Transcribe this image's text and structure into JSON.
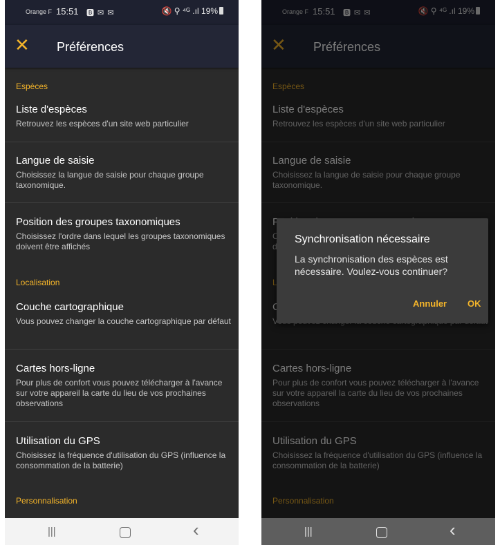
{
  "status_bar": {
    "carrier": "Orange F",
    "time": "15:51",
    "notifications": "🅱 ✉ ✉",
    "system_icons": "🔇 ⚲ ⁴ᴳ .ıl",
    "battery": "19%"
  },
  "app_bar": {
    "close_icon": "✕",
    "title": "Préférences"
  },
  "sections": {
    "especes": "Espèces",
    "localisation": "Localisation",
    "personnalisation": "Personnalisation"
  },
  "items": [
    {
      "title": "Liste d'espèces",
      "subtitle": "Retrouvez les espèces d'un site web particulier"
    },
    {
      "title": "Langue de saisie",
      "subtitle": "Choisissez la langue de saisie pour chaque groupe taxonomique."
    },
    {
      "title": "Position des groupes taxonomiques",
      "subtitle": "Choisissez l'ordre dans lequel les groupes taxonomiques doivent être affichés"
    },
    {
      "title": "Couche cartographique",
      "subtitle": "Vous pouvez changer la couche cartographique par défaut"
    },
    {
      "title": "Cartes hors-ligne",
      "subtitle": "Pour plus de confort vous pouvez télécharger à l'avance sur votre appareil la carte du lieu de vos prochaines observations"
    },
    {
      "title": "Utilisation du GPS",
      "subtitle": "Choisissez la fréquence d'utilisation du GPS (influence la consommation de la batterie)"
    }
  ],
  "nav_bar": {
    "recents": "|||",
    "back": "‹"
  },
  "dialog": {
    "title": "Synchronisation nécessaire",
    "message": "La synchronisation des espèces est nécessaire. Voulez-vous continuer?",
    "cancel_label": "Annuler",
    "ok_label": "OK"
  },
  "colors": {
    "accent": "#f5b52a",
    "background": "#2b2b2b",
    "app_bar": "#232636"
  }
}
